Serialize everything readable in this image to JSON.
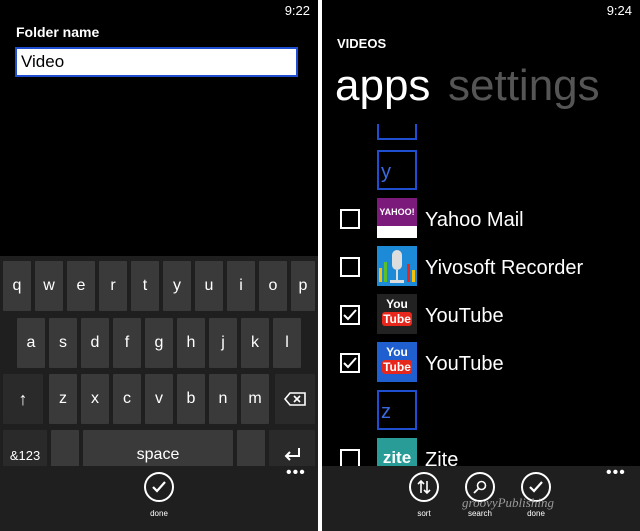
{
  "left": {
    "clock": "9:22",
    "label": "Folder name",
    "input_value": "Video",
    "keys": {
      "row1": [
        "q",
        "w",
        "e",
        "r",
        "t",
        "y",
        "u",
        "i",
        "o",
        "p"
      ],
      "row2": [
        "a",
        "s",
        "d",
        "f",
        "g",
        "h",
        "j",
        "k",
        "l"
      ],
      "row3": [
        "z",
        "x",
        "c",
        "v",
        "b",
        "n",
        "m"
      ],
      "sym": "&123",
      "space": "space"
    },
    "appbar": {
      "done": "done",
      "more": "•••"
    }
  },
  "right": {
    "clock": "9:24",
    "title": "VIDEOS",
    "pivot_active": "apps",
    "pivot_inactive": "settings",
    "letter_tiles": [
      "y",
      "z"
    ],
    "apps": [
      {
        "name": "Yahoo Mail",
        "checked": false,
        "icon": "yahoo-mail-icon"
      },
      {
        "name": "Yivosoft Recorder",
        "checked": false,
        "icon": "microphone-icon"
      },
      {
        "name": "YouTube",
        "checked": true,
        "icon": "youtube-icon"
      },
      {
        "name": "YouTube",
        "checked": true,
        "icon": "youtube-icon"
      },
      {
        "name": "Zite",
        "checked": false,
        "icon": "zite-icon"
      }
    ],
    "yahoo_logo_text": "YAHOO!",
    "youtube_logo_top": "You",
    "youtube_logo_bottom": "Tube",
    "zite_logo_text": "zite",
    "appbar": {
      "sort": "sort",
      "search": "search",
      "done": "done",
      "more": "•••"
    },
    "watermark": "groovyPublishing"
  },
  "colors": {
    "accent": "#1f4fd0",
    "youtube_red": "#e8271c",
    "zite_teal": "#2a9c97"
  }
}
